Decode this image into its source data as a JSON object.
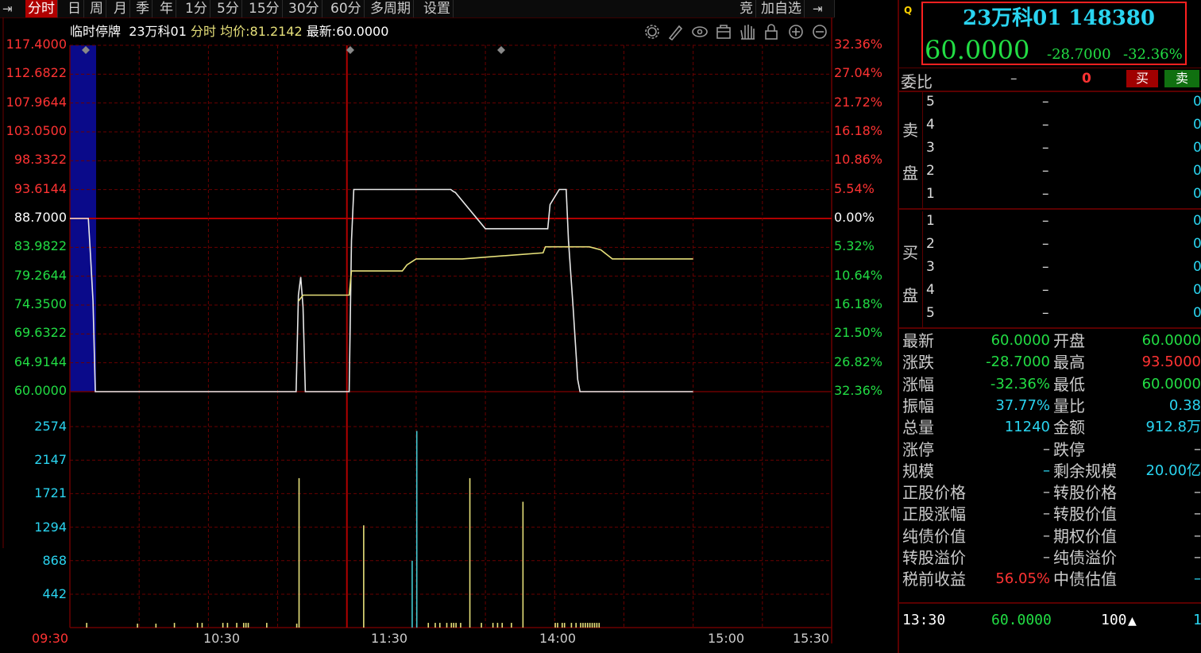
{
  "toolbar": {
    "left_icon": "collapse-arrow",
    "periods": [
      "分时",
      "日",
      "周",
      "月",
      "季",
      "年",
      "1分",
      "5分",
      "15分",
      "30分",
      "60分",
      "多周期",
      "设置"
    ],
    "right_items": [
      "竞",
      "加自选"
    ],
    "right_icon": "expand-arrow"
  },
  "info": {
    "status": "临时停牌",
    "name": "23万科01",
    "mode": "分时",
    "avg_label": "均价:",
    "avg_value": "81.2142",
    "last_label": "最新:",
    "last_value": "60.0000"
  },
  "chart_icons": [
    "gear-icon",
    "pen-icon",
    "eye-icon",
    "case-icon",
    "hand-icon",
    "lock-icon",
    "zoom-in-icon",
    "zoom-out-icon"
  ],
  "chart_data": {
    "type": "line",
    "price_axis": [
      "117.4000",
      "112.6822",
      "107.9644",
      "103.0500",
      "98.3322",
      "93.6144",
      "88.7000",
      "83.9822",
      "79.2644",
      "74.3500",
      "69.6322",
      "64.9144",
      "60.0000"
    ],
    "pct_axis": [
      "32.36%",
      "27.04%",
      "21.72%",
      "16.18%",
      "10.86%",
      "5.54%",
      "0.00%",
      "5.32%",
      "10.64%",
      "16.18%",
      "21.50%",
      "26.82%",
      "32.36%"
    ],
    "volume_axis": [
      "2574",
      "2147",
      "1721",
      "1294",
      "868",
      "442"
    ],
    "time_axis": [
      "09:30",
      "10:30",
      "11:30",
      "14:00",
      "15:00",
      "15:30"
    ],
    "prev_close": 88.7,
    "ylim": [
      60.0,
      117.4
    ],
    "series": [
      {
        "role": "price",
        "color": "#e8e8e8",
        "t": [
          0,
          8,
          9,
          10,
          11,
          40,
          98,
          99,
          100,
          101,
          102,
          121,
          122,
          123,
          165,
          166,
          167,
          180,
          190,
          200,
          207,
          208,
          212,
          215,
          216,
          218,
          220,
          221,
          222,
          223,
          270
        ],
        "v": [
          88.7,
          88.7,
          82,
          75,
          60,
          60,
          60,
          76,
          79,
          74,
          60,
          60,
          85,
          93.5,
          93.5,
          93.2,
          93,
          87,
          87,
          87,
          87,
          91,
          93.5,
          93.5,
          85,
          74,
          62,
          60,
          60,
          60,
          60
        ]
      },
      {
        "role": "average",
        "color": "#e6e07a",
        "t": [
          99,
          101,
          102,
          121,
          122,
          123,
          140,
          144,
          146,
          150,
          170,
          205,
          206,
          207,
          208,
          210,
          220,
          225,
          230,
          235,
          240,
          270
        ],
        "v": [
          75,
          76,
          76,
          76,
          80,
          80,
          80,
          80,
          81,
          82,
          82,
          83,
          84,
          84,
          84,
          84,
          84,
          84,
          83.5,
          82,
          82,
          82
        ]
      }
    ],
    "volume": {
      "t": [
        7,
        29,
        37,
        45,
        55,
        57,
        66,
        68,
        72,
        75,
        76,
        77,
        85,
        98,
        99,
        127,
        148,
        150,
        155,
        158,
        160,
        163,
        165,
        166,
        167,
        169,
        173,
        178,
        183,
        185,
        187,
        191,
        196,
        210,
        211,
        213,
        214,
        217,
        219,
        221,
        222,
        223,
        224,
        225,
        226,
        227,
        228,
        229
      ],
      "v": [
        60,
        50,
        50,
        60,
        60,
        60,
        60,
        60,
        60,
        60,
        60,
        60,
        60,
        50,
        1900,
        1300,
        850,
        2500,
        60,
        60,
        60,
        60,
        60,
        60,
        60,
        60,
        1900,
        60,
        60,
        60,
        60,
        60,
        1600,
        60,
        60,
        60,
        60,
        60,
        60,
        60,
        60,
        60,
        60,
        60,
        60,
        60,
        60,
        60
      ],
      "colors": {
        "up": "#e6e07a",
        "down": "#42c8d0",
        "flat": "#e6e07a"
      }
    }
  },
  "quote": {
    "badge": "Q",
    "title": "23万科01 148380",
    "price": "60.0000",
    "change": "-28.7000",
    "change_pct": "-32.36%"
  },
  "order_ratio": {
    "label": "委比",
    "val1": "–",
    "val2": "0",
    "buy_btn": "买",
    "sell_btn": "卖"
  },
  "sell_book": {
    "label_top": "卖",
    "label_bottom": "盘",
    "rows": [
      {
        "lvl": "5",
        "price": "–",
        "vol": "0"
      },
      {
        "lvl": "4",
        "price": "–",
        "vol": "0"
      },
      {
        "lvl": "3",
        "price": "–",
        "vol": "0"
      },
      {
        "lvl": "2",
        "price": "–",
        "vol": "0"
      },
      {
        "lvl": "1",
        "price": "–",
        "vol": "0"
      }
    ]
  },
  "buy_book": {
    "label_top": "买",
    "label_bottom": "盘",
    "rows": [
      {
        "lvl": "1",
        "price": "–",
        "vol": "0"
      },
      {
        "lvl": "2",
        "price": "–",
        "vol": "0"
      },
      {
        "lvl": "3",
        "price": "–",
        "vol": "0"
      },
      {
        "lvl": "4",
        "price": "–",
        "vol": "0"
      },
      {
        "lvl": "5",
        "price": "–",
        "vol": "0"
      }
    ]
  },
  "stats": [
    {
      "l1": "最新",
      "v1": "60.0000",
      "c1": "#22dd44",
      "l2": "开盘",
      "v2": "60.0000",
      "c2": "#22dd44"
    },
    {
      "l1": "涨跌",
      "v1": "-28.7000",
      "c1": "#22dd44",
      "l2": "最高",
      "v2": "93.5000",
      "c2": "#ff3333"
    },
    {
      "l1": "涨幅",
      "v1": "-32.36%",
      "c1": "#22dd44",
      "l2": "最低",
      "v2": "60.0000",
      "c2": "#22dd44"
    },
    {
      "l1": "振幅",
      "v1": "37.77%",
      "c1": "#2ad4f0",
      "l2": "量比",
      "v2": "0.38",
      "c2": "#2ad4f0"
    },
    {
      "l1": "总量",
      "v1": "11240",
      "c1": "#2ad4f0",
      "l2": "金额",
      "v2": "912.8万",
      "c2": "#2ad4f0"
    },
    {
      "l1": "涨停",
      "v1": "–",
      "c1": "#cccccc",
      "l2": "跌停",
      "v2": "–",
      "c2": "#cccccc"
    },
    {
      "l1": "规模",
      "v1": "–",
      "c1": "#2ad4f0",
      "l2": "剩余规模",
      "v2": "20.00亿",
      "c2": "#2ad4f0"
    },
    {
      "l1": "正股价格",
      "v1": "–",
      "c1": "#cccccc",
      "l2": "转股价格",
      "v2": "–",
      "c2": "#cccccc"
    },
    {
      "l1": "正股涨幅",
      "v1": "–",
      "c1": "#cccccc",
      "l2": "转股价值",
      "v2": "–",
      "c2": "#cccccc"
    },
    {
      "l1": "纯债价值",
      "v1": "–",
      "c1": "#cccccc",
      "l2": "期权价值",
      "v2": "–",
      "c2": "#cccccc"
    },
    {
      "l1": "转股溢价",
      "v1": "–",
      "c1": "#cccccc",
      "l2": "纯债溢价",
      "v2": "–",
      "c2": "#cccccc"
    },
    {
      "l1": "税前收益",
      "v1": "56.05%",
      "c1": "#ff3333",
      "l2": "中债估值",
      "v2": "–",
      "c2": "#2ad4f0"
    }
  ],
  "trade": {
    "time": "13:30",
    "price": "60.0000",
    "vol": "100",
    "arrow": "up-arrow-icon",
    "extra": "1"
  },
  "colors": {
    "up": "#ff3333",
    "down": "#22dd44",
    "grid": "#6a0000",
    "highlight": "#ff2020",
    "info": "#2ad4f0"
  }
}
